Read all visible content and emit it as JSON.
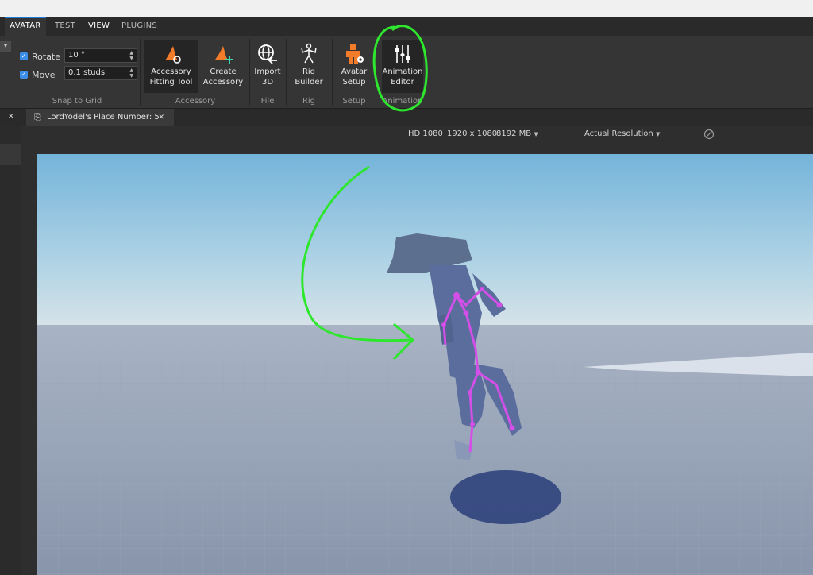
{
  "ribbon_tabs": [
    "AVATAR",
    "TEST",
    "VIEW",
    "PLUGINS"
  ],
  "snap": {
    "rotate_label": "Rotate",
    "rotate_value": "10 °",
    "move_label": "Move",
    "move_value": "0.1 studs",
    "group_label": "Snap to Grid"
  },
  "tools": {
    "accessory_fitting": "Accessory\nFitting Tool",
    "create_accessory": "Create\nAccessory",
    "import_3d": "Import\n3D",
    "rig_builder": "Rig\nBuilder",
    "avatar_setup": "Avatar\nSetup",
    "animation_editor": "Animation\nEditor"
  },
  "groups": {
    "accessory": "Accessory",
    "file": "File",
    "rig": "Rig",
    "setup": "Setup",
    "animation": "Animation"
  },
  "document_tab": "LordYodel's Place Number: 5",
  "close_glyph": "✕",
  "viewport_status": {
    "quality": "HD 1080",
    "resolution": "1920 x 1080",
    "memory": "8192 MB",
    "mode": "Actual Resolution"
  },
  "colors": {
    "accent_blue": "#1e7ad6",
    "icon_orange": "#f37c2a",
    "annotation_green": "#2ee62e",
    "rig_magenta": "#d44fe8"
  }
}
